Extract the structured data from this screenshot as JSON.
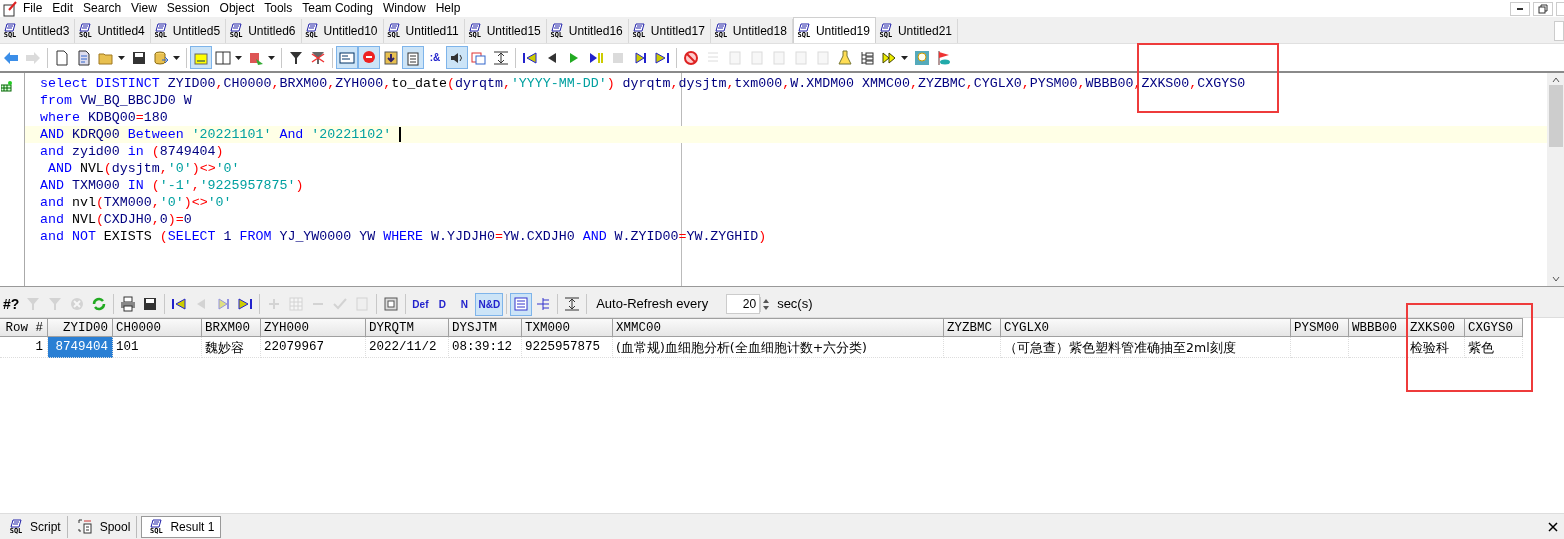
{
  "menu": [
    "File",
    "Edit",
    "Search",
    "View",
    "Session",
    "Object",
    "Tools",
    "Team Coding",
    "Window",
    "Help"
  ],
  "tabs": [
    {
      "label": "Untitled3",
      "icon_text": "SQL",
      "selected": false
    },
    {
      "label": "Untitled4",
      "icon_text": "SQL",
      "selected": false
    },
    {
      "label": "Untitled5",
      "icon_text": "SQL",
      "selected": false
    },
    {
      "label": "Untitled6",
      "icon_text": "SQL",
      "selected": false
    },
    {
      "label": "Untitled10",
      "icon_text": "SQL",
      "selected": false
    },
    {
      "label": "Untitled11",
      "icon_text": "SQL",
      "selected": false
    },
    {
      "label": "Untitled15",
      "icon_text": "SQL",
      "selected": false
    },
    {
      "label": "Untitled16",
      "icon_text": "SQL",
      "selected": false
    },
    {
      "label": "Untitled17",
      "icon_text": "SQL",
      "selected": false
    },
    {
      "label": "Untitled18",
      "icon_text": "SQL",
      "selected": false
    },
    {
      "label": "Untitled19",
      "icon_text": "SQL",
      "selected": true
    },
    {
      "label": "Untitled21",
      "icon_text": "SQL",
      "selected": false
    }
  ],
  "toolbar": [
    {
      "kind": "button",
      "pressed": false,
      "disabled": false
    },
    {
      "kind": "button",
      "pressed": false,
      "disabled": true
    },
    {
      "kind": "separator"
    },
    {
      "kind": "button",
      "pressed": false,
      "disabled": false
    },
    {
      "kind": "button",
      "pressed": false,
      "disabled": false
    },
    {
      "kind": "split",
      "pressed": false,
      "disabled": false
    },
    {
      "kind": "button",
      "pressed": false,
      "disabled": false
    },
    {
      "kind": "split",
      "pressed": false,
      "disabled": false
    },
    {
      "kind": "separator"
    },
    {
      "kind": "button",
      "pressed": true,
      "disabled": false
    },
    {
      "kind": "split",
      "pressed": false,
      "disabled": false
    },
    {
      "kind": "split",
      "pressed": false,
      "disabled": false
    },
    {
      "kind": "separator"
    },
    {
      "kind": "button",
      "pressed": false,
      "disabled": false
    },
    {
      "kind": "button",
      "pressed": false,
      "disabled": false
    },
    {
      "kind": "separator"
    },
    {
      "kind": "button",
      "pressed": true,
      "disabled": false
    },
    {
      "kind": "button",
      "pressed": true,
      "disabled": false
    },
    {
      "kind": "button",
      "pressed": false,
      "disabled": false
    },
    {
      "kind": "button",
      "pressed": true,
      "disabled": false
    },
    {
      "kind": "glyph",
      "text": ":&",
      "pressed": false,
      "disabled": false
    },
    {
      "kind": "button",
      "pressed": true,
      "disabled": false
    },
    {
      "kind": "button",
      "pressed": false,
      "disabled": false
    },
    {
      "kind": "button",
      "pressed": false,
      "disabled": false
    },
    {
      "kind": "separator"
    },
    {
      "kind": "button",
      "pressed": false,
      "disabled": false
    },
    {
      "kind": "button",
      "pressed": false,
      "disabled": false
    },
    {
      "kind": "button",
      "pressed": false,
      "disabled": false
    },
    {
      "kind": "button",
      "pressed": false,
      "disabled": false
    },
    {
      "kind": "button",
      "pressed": false,
      "disabled": true
    },
    {
      "kind": "button",
      "pressed": false,
      "disabled": false
    },
    {
      "kind": "button",
      "pressed": false,
      "disabled": false
    },
    {
      "kind": "separator"
    },
    {
      "kind": "button",
      "pressed": false,
      "disabled": false
    },
    {
      "kind": "button",
      "pressed": false,
      "disabled": true
    },
    {
      "kind": "button",
      "pressed": false,
      "disabled": true
    },
    {
      "kind": "button",
      "pressed": false,
      "disabled": true
    },
    {
      "kind": "button",
      "pressed": false,
      "disabled": true
    },
    {
      "kind": "button",
      "pressed": false,
      "disabled": true
    },
    {
      "kind": "button",
      "pressed": false,
      "disabled": true
    },
    {
      "kind": "button",
      "pressed": false,
      "disabled": false
    },
    {
      "kind": "button",
      "pressed": false,
      "disabled": false
    },
    {
      "kind": "split",
      "pressed": false,
      "disabled": false
    },
    {
      "kind": "button",
      "pressed": false,
      "disabled": false
    },
    {
      "kind": "button",
      "pressed": false,
      "disabled": false
    }
  ],
  "sql_lines": [
    {
      "current": false,
      "tokens": [
        {
          "kind": "kw",
          "text": "select DISTINCT "
        },
        {
          "kind": "id",
          "text": "ZYID00"
        },
        {
          "kind": "op",
          "text": ","
        },
        {
          "kind": "id",
          "text": "CH0000"
        },
        {
          "kind": "op",
          "text": ","
        },
        {
          "kind": "id",
          "text": "BRXM00"
        },
        {
          "kind": "op",
          "text": ","
        },
        {
          "kind": "id",
          "text": "ZYH000"
        },
        {
          "kind": "op",
          "text": ","
        },
        {
          "kind": "fn",
          "text": "to_date"
        },
        {
          "kind": "op",
          "text": "("
        },
        {
          "kind": "id",
          "text": "dyrqtm"
        },
        {
          "kind": "op",
          "text": ","
        },
        {
          "kind": "str",
          "text": "'YYYY-MM-DD'"
        },
        {
          "kind": "op",
          "text": ")"
        },
        {
          "kind": "id",
          "text": " dyrqtm"
        },
        {
          "kind": "op",
          "text": ","
        },
        {
          "kind": "id",
          "text": "dysjtm"
        },
        {
          "kind": "op",
          "text": ","
        },
        {
          "kind": "id",
          "text": "txm000"
        },
        {
          "kind": "op",
          "text": ","
        },
        {
          "kind": "id",
          "text": "W.XMDM00 XMMC00"
        },
        {
          "kind": "op",
          "text": ","
        },
        {
          "kind": "id",
          "text": "ZYZBMC"
        },
        {
          "kind": "op",
          "text": ","
        },
        {
          "kind": "id",
          "text": "CYGLX0"
        },
        {
          "kind": "op",
          "text": ","
        },
        {
          "kind": "id",
          "text": "PYSM00"
        },
        {
          "kind": "op",
          "text": ","
        },
        {
          "kind": "id",
          "text": "WBBB00"
        },
        {
          "kind": "op",
          "text": ","
        },
        {
          "kind": "id",
          "text": "ZXKS00"
        },
        {
          "kind": "op",
          "text": ","
        },
        {
          "kind": "id",
          "text": "CXGYS0"
        }
      ]
    },
    {
      "current": false,
      "tokens": [
        {
          "kind": "kw",
          "text": "from "
        },
        {
          "kind": "id",
          "text": "VW_BQ_BBCJD0 W"
        }
      ]
    },
    {
      "current": false,
      "tokens": [
        {
          "kind": "kw",
          "text": "where "
        },
        {
          "kind": "id",
          "text": "KDBQ00"
        },
        {
          "kind": "op",
          "text": "="
        },
        {
          "kind": "id",
          "text": "180"
        }
      ]
    },
    {
      "current": true,
      "tokens": [
        {
          "kind": "kw",
          "text": "AND "
        },
        {
          "kind": "id",
          "text": "KDRQ00 "
        },
        {
          "kind": "kw",
          "text": "Between "
        },
        {
          "kind": "str",
          "text": "'20221101'"
        },
        {
          "kind": "kw",
          "text": " And "
        },
        {
          "kind": "str",
          "text": "'20221102'"
        }
      ]
    },
    {
      "current": false,
      "tokens": [
        {
          "kind": "kw",
          "text": "and "
        },
        {
          "kind": "id",
          "text": "zyid00 "
        },
        {
          "kind": "kw",
          "text": "in "
        },
        {
          "kind": "op",
          "text": "("
        },
        {
          "kind": "id",
          "text": "8749404"
        },
        {
          "kind": "op",
          "text": ")"
        }
      ]
    },
    {
      "current": false,
      "tokens": [
        {
          "kind": "kw",
          "text": " AND "
        },
        {
          "kind": "fn",
          "text": "NVL"
        },
        {
          "kind": "op",
          "text": "("
        },
        {
          "kind": "id",
          "text": "dysjtm"
        },
        {
          "kind": "op",
          "text": ","
        },
        {
          "kind": "str",
          "text": "'0'"
        },
        {
          "kind": "op",
          "text": ")<>"
        },
        {
          "kind": "str",
          "text": "'0'"
        }
      ]
    },
    {
      "current": false,
      "tokens": [
        {
          "kind": "kw",
          "text": "AND "
        },
        {
          "kind": "id",
          "text": "TXM000 "
        },
        {
          "kind": "kw",
          "text": "IN "
        },
        {
          "kind": "op",
          "text": "("
        },
        {
          "kind": "str",
          "text": "'-1'"
        },
        {
          "kind": "op",
          "text": ","
        },
        {
          "kind": "str",
          "text": "'9225957875'"
        },
        {
          "kind": "op",
          "text": ")"
        }
      ]
    },
    {
      "current": false,
      "tokens": [
        {
          "kind": "kw",
          "text": "and "
        },
        {
          "kind": "fn",
          "text": "nvl"
        },
        {
          "kind": "op",
          "text": "("
        },
        {
          "kind": "id",
          "text": "TXM000"
        },
        {
          "kind": "op",
          "text": ","
        },
        {
          "kind": "str",
          "text": "'0'"
        },
        {
          "kind": "op",
          "text": ")<>"
        },
        {
          "kind": "str",
          "text": "'0'"
        }
      ]
    },
    {
      "current": false,
      "tokens": [
        {
          "kind": "kw",
          "text": "and "
        },
        {
          "kind": "fn",
          "text": "NVL"
        },
        {
          "kind": "op",
          "text": "("
        },
        {
          "kind": "id",
          "text": "CXDJH0"
        },
        {
          "kind": "op",
          "text": ","
        },
        {
          "kind": "id",
          "text": "0"
        },
        {
          "kind": "op",
          "text": ")="
        },
        {
          "kind": "id",
          "text": "0"
        }
      ]
    },
    {
      "current": false,
      "tokens": [
        {
          "kind": "kw",
          "text": "and NOT "
        },
        {
          "kind": "fn",
          "text": "EXISTS "
        },
        {
          "kind": "op",
          "text": "("
        },
        {
          "kind": "kw",
          "text": "SELECT "
        },
        {
          "kind": "id",
          "text": "1 "
        },
        {
          "kind": "kw",
          "text": "FROM "
        },
        {
          "kind": "id",
          "text": "YJ_YW0000 YW "
        },
        {
          "kind": "kw",
          "text": "WHERE "
        },
        {
          "kind": "id",
          "text": "W.YJDJH0"
        },
        {
          "kind": "op",
          "text": "="
        },
        {
          "kind": "id",
          "text": "YW.CXDJH0 "
        },
        {
          "kind": "kw",
          "text": "AND "
        },
        {
          "kind": "id",
          "text": "W.ZYID00"
        },
        {
          "kind": "op",
          "text": "="
        },
        {
          "kind": "id",
          "text": "YW.ZYGHID"
        },
        {
          "kind": "op",
          "text": ")"
        }
      ]
    }
  ],
  "grid_toolbar": [
    {
      "kind": "glyph",
      "text": "#?",
      "pressed": false,
      "disabled": false
    },
    {
      "kind": "button",
      "pressed": false,
      "disabled": true
    },
    {
      "kind": "button",
      "pressed": false,
      "disabled": true
    },
    {
      "kind": "button",
      "pressed": false,
      "disabled": true
    },
    {
      "kind": "button",
      "pressed": false,
      "disabled": false
    },
    {
      "kind": "separator"
    },
    {
      "kind": "button",
      "pressed": false,
      "disabled": false
    },
    {
      "kind": "button",
      "pressed": false,
      "disabled": false
    },
    {
      "kind": "separator"
    },
    {
      "kind": "button",
      "pressed": false,
      "disabled": false
    },
    {
      "kind": "button",
      "pressed": false,
      "disabled": true
    },
    {
      "kind": "button",
      "pressed": false,
      "disabled": true
    },
    {
      "kind": "button",
      "pressed": false,
      "disabled": false
    },
    {
      "kind": "separator"
    },
    {
      "kind": "button",
      "pressed": false,
      "disabled": true
    },
    {
      "kind": "button",
      "pressed": false,
      "disabled": true
    },
    {
      "kind": "button",
      "pressed": false,
      "disabled": true
    },
    {
      "kind": "button",
      "pressed": false,
      "disabled": true
    },
    {
      "kind": "button",
      "pressed": false,
      "disabled": true
    },
    {
      "kind": "separator"
    },
    {
      "kind": "button",
      "pressed": false,
      "disabled": false
    },
    {
      "kind": "separator"
    },
    {
      "kind": "glyph",
      "text": "Def",
      "pressed": false,
      "disabled": false
    },
    {
      "kind": "glyph",
      "text": "D",
      "pressed": false,
      "disabled": false
    },
    {
      "kind": "glyph",
      "text": "N",
      "pressed": false,
      "disabled": false
    },
    {
      "kind": "glyph",
      "text": "N&D",
      "pressed": true,
      "disabled": false
    },
    {
      "kind": "separator"
    },
    {
      "kind": "button",
      "pressed": true,
      "disabled": false
    },
    {
      "kind": "button",
      "pressed": false,
      "disabled": false
    },
    {
      "kind": "separator"
    },
    {
      "kind": "button",
      "pressed": false,
      "disabled": false
    },
    {
      "kind": "separator"
    }
  ],
  "auto_refresh": {
    "label": "Auto-Refresh every",
    "value": "20",
    "unit": "sec(s)"
  },
  "grid": {
    "columns": [
      "Row #",
      "ZYID00",
      "CH0000",
      "BRXM00",
      "ZYH000",
      "DYRQTM",
      "DYSJTM",
      "TXM000",
      "XMMC00",
      "ZYZBMC",
      "CYGLX0",
      "PYSM00",
      "WBBB00",
      "ZXKS00",
      "CXGYS0"
    ],
    "rows": [
      {
        "cells": [
          {
            "text": "1",
            "selected": false
          },
          {
            "text": "8749404",
            "selected": true
          },
          {
            "text": "101",
            "selected": false
          },
          {
            "text": "魏妙容",
            "selected": false
          },
          {
            "text": "22079967",
            "selected": false
          },
          {
            "text": "2022/11/2",
            "selected": false
          },
          {
            "text": "08:39:12",
            "selected": false
          },
          {
            "text": "9225957875",
            "selected": false
          },
          {
            "text": "(血常规)血细胞分析(全血细胞计数+六分类)",
            "selected": false
          },
          {
            "selected": false
          },
          {
            "text": "（可急查）紫色塑料管准确抽至2ml刻度",
            "selected": false
          },
          {
            "selected": false
          },
          {
            "selected": false
          },
          {
            "text": "检验科",
            "selected": false
          },
          {
            "text": "紫色",
            "selected": false
          }
        ]
      }
    ]
  },
  "bottom_tabs": [
    {
      "label": "Script",
      "icon_text": "SQL",
      "selected": false
    },
    {
      "label": "Spool",
      "selected": false
    },
    {
      "label": "Result 1",
      "icon_text": "SQL",
      "selected": true
    }
  ],
  "annotations": [
    {
      "kind": "box",
      "color": "#ee3b3b"
    },
    {
      "kind": "box",
      "color": "#ee3b3b"
    }
  ]
}
